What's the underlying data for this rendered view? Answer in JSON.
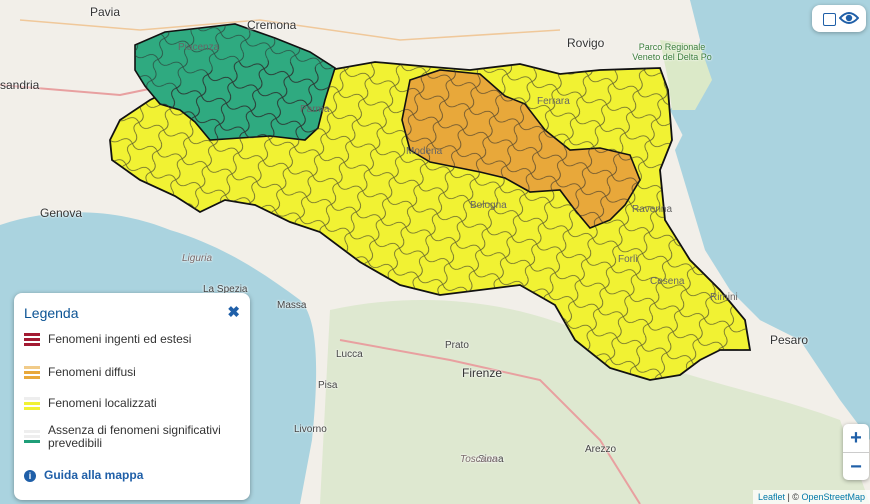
{
  "map_labels": {
    "pavia": "Pavia",
    "cremona": "Cremona",
    "rovigo": "Rovigo",
    "alessandria": "sandria",
    "genova": "Genova",
    "piacenza": "Piacenza",
    "parma": "Parma",
    "modena": "Modena",
    "ferrara": "Ferrara",
    "bologna": "Bologna",
    "ravenna": "Ravenna",
    "forli": "Forlì",
    "cesena": "Cesena",
    "rimini": "Rimini",
    "pesaro": "Pesaro",
    "la_spezia": "La Spezia",
    "massa": "Massa",
    "lucca": "Lucca",
    "prato": "Prato",
    "firenze": "Firenze",
    "pisa": "Pisa",
    "livorno": "Livorno",
    "siena": "Siena",
    "arezzo": "Arezzo",
    "liguria": "Liguria",
    "toscana": "Toscana",
    "park": "Parco Regionale Veneto del Delta Po"
  },
  "legend": {
    "title": "Legenda",
    "close_icon": "x-icon",
    "items": [
      {
        "label": "Fenomeni ingenti ed estesi",
        "color": "#a31a32"
      },
      {
        "label": "Fenomeni diffusi",
        "color": "#e8a83a"
      },
      {
        "label": "Fenomeni localizzati",
        "color": "#f1f233"
      },
      {
        "label": "Assenza di fenomeni significativi prevedibili",
        "color": "#1f9e78"
      }
    ],
    "guide": "Guida alla mappa",
    "guide_icon": "info-icon"
  },
  "controls": {
    "toggle_icons": [
      "checkbox-icon",
      "eye-icon"
    ],
    "zoom_in": "+",
    "zoom_out": "−"
  },
  "attribution": {
    "leaflet": "Leaflet",
    "sep": " | © ",
    "osm": "OpenStreetMap"
  }
}
